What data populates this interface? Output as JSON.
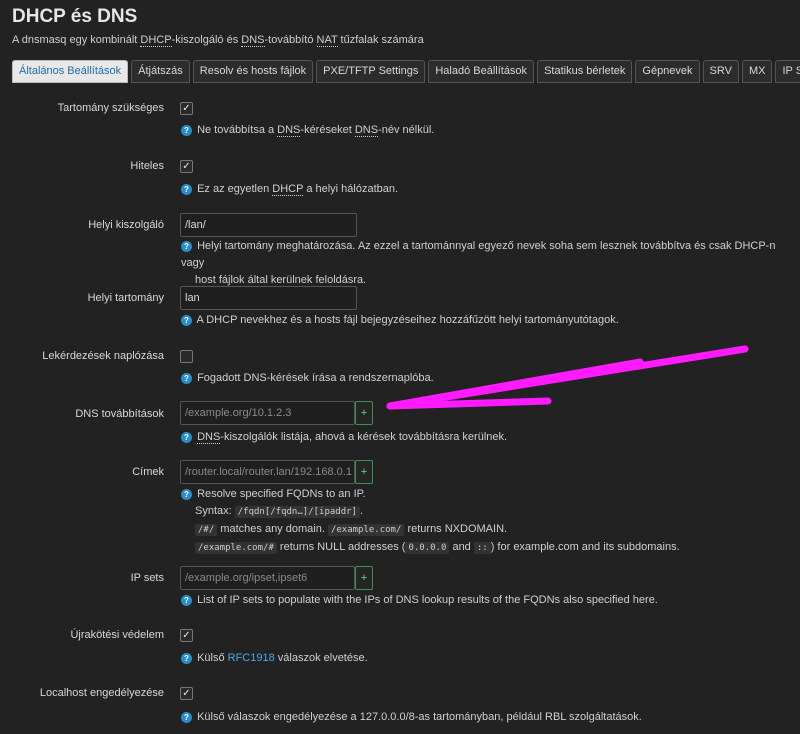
{
  "page": {
    "title": "DHCP és DNS",
    "subtitle_pre": "A dnsmasq egy kombinált ",
    "subtitle_abbr1": "DHCP",
    "subtitle_mid1": "-kiszolgáló és ",
    "subtitle_abbr2": "DNS",
    "subtitle_mid2": "-továbbító ",
    "subtitle_abbr3": "NAT",
    "subtitle_post": " tűzfalak számára"
  },
  "tabs": [
    {
      "label": "Általános Beállítások",
      "active": true
    },
    {
      "label": "Átjátszás"
    },
    {
      "label": "Resolv és hosts fájlok"
    },
    {
      "label": "PXE/TFTP Settings"
    },
    {
      "label": "Haladó Beállítások"
    },
    {
      "label": "Statikus bérletek"
    },
    {
      "label": "Gépnevek"
    },
    {
      "label": "SRV"
    },
    {
      "label": "MX"
    },
    {
      "label": "IP Sets"
    }
  ],
  "fields": {
    "domain_required": {
      "label": "Tartomány szükséges",
      "checked": true,
      "help_pre": "Ne továbbítsa a ",
      "help_abbr1": "DNS",
      "help_mid": "-kéréseket ",
      "help_abbr2": "DNS",
      "help_post": "-név nélkül."
    },
    "authoritative": {
      "label": "Hiteles",
      "checked": true,
      "help_pre": "Ez az egyetlen ",
      "help_abbr": "DHCP",
      "help_post": " a helyi hálózatban."
    },
    "local_server": {
      "label": "Helyi kiszolgáló",
      "value": "/lan/",
      "help_line1": "Helyi tartomány meghatározása. Az ezzel a tartománnyal egyező nevek soha sem lesznek továbbítva és csak DHCP-n vagy",
      "help_line2": "host fájlok által kerülnek feloldásra."
    },
    "local_domain": {
      "label": "Helyi tartomány",
      "value": "lan",
      "help": "A DHCP nevekhez és a hosts fájl bejegyzéseihez hozzáfűzött helyi tartományutótagok."
    },
    "log_queries": {
      "label": "Lekérdezések naplózása",
      "checked": false,
      "help": "Fogadott DNS-kérések írása a rendszernaplóba."
    },
    "dns_forwardings": {
      "label": "DNS továbbítások",
      "placeholder": "/example.org/10.1.2.3",
      "add": "+",
      "help_abbr": "DNS",
      "help_post": "-kiszolgálók listája, ahová a kérések továbbításra kerülnek."
    },
    "addresses": {
      "label": "Címek",
      "placeholder": "/router.local/router.lan/192.168.0.1",
      "add": "+",
      "help_line1": "Resolve specified FQDNs to an IP.",
      "syntax_label": "Syntax:",
      "syntax_code": "/fqdn[/fqdn…]/[ipaddr]",
      "syntax_end": ".",
      "l3_code1": "/#/",
      "l3_mid": " matches any domain. ",
      "l3_code2": "/example.com/",
      "l3_post": " returns NXDOMAIN.",
      "l4_code1": "/example.com/#",
      "l4_mid1": " returns NULL addresses (",
      "l4_code2": "0.0.0.0",
      "l4_mid2": " and ",
      "l4_code3": "::",
      "l4_post": ") for example.com and its subdomains."
    },
    "ipsets": {
      "label": "IP sets",
      "placeholder": "/example.org/ipset,ipset6",
      "add": "+",
      "help": "List of IP sets to populate with the IPs of DNS lookup results of the FQDNs also specified here."
    },
    "rebind_protection": {
      "label": "Újrakötési védelem",
      "checked": true,
      "help_pre": "Külső ",
      "help_link": "RFC1918",
      "help_post": " válaszok elvetése."
    },
    "localhost_allowed": {
      "label": "Localhost engedélyezése",
      "checked": true,
      "help": "Külső válaszok engedélyezése a 127.0.0.0/8-as tartományban, például RBL szolgáltatások."
    }
  },
  "icons": {
    "help": "question-circle-icon",
    "check": "✓",
    "help_glyph": "?"
  },
  "colors": {
    "annotation_arrow": "#ff1aff",
    "accent": "#2a8dc8",
    "add_button": "#3f8c55"
  }
}
